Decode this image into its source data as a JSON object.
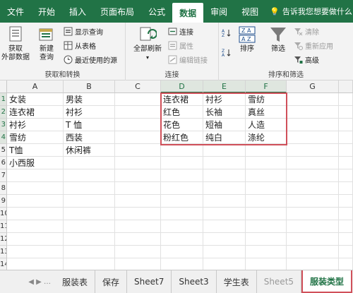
{
  "ribbon_tabs": [
    "文件",
    "开始",
    "插入",
    "页面布局",
    "公式",
    "数据",
    "审阅",
    "视图"
  ],
  "active_tab": "数据",
  "tell_me": "告诉我您想要做什么",
  "groups": {
    "get_transform": {
      "label": "获取和转换",
      "get_external": "获取\n外部数据",
      "new_query": "新建\n查询",
      "show_queries": "显示查询",
      "from_table": "从表格",
      "recent_sources": "最近使用的源"
    },
    "connections": {
      "label": "连接",
      "refresh_all": "全部刷新",
      "connections": "连接",
      "properties": "属性",
      "edit_links": "编辑链接"
    },
    "sort_filter": {
      "label": "排序和筛选",
      "sort": "排序",
      "filter": "筛选",
      "clear": "清除",
      "reapply": "重新应用",
      "advanced": "高级"
    }
  },
  "columns": [
    "A",
    "B",
    "C",
    "D",
    "E",
    "F",
    "G"
  ],
  "rows": [
    "1",
    "2",
    "3",
    "4",
    "5",
    "6",
    "7",
    "8",
    "9",
    "10",
    "11",
    "12",
    "13",
    "14"
  ],
  "cells": {
    "A1": "女装",
    "A2": "连衣裙",
    "A3": "衬衫",
    "A4": "雪纺",
    "A5": "T恤",
    "A6": "小西服",
    "B1": "男装",
    "B2": "衬衫",
    "B3": "T 恤",
    "B4": "西装",
    "B5": "休闲裤",
    "D1": "连衣裙",
    "D2": "红色",
    "D3": "花色",
    "D4": "粉红色",
    "E1": "衬衫",
    "E2": "长袖",
    "E3": "短袖",
    "E4": "纯白",
    "F1": "雪纺",
    "F2": "真丝",
    "F3": "人造",
    "F4": "涤纶"
  },
  "sheet_tabs": [
    "服装表",
    "保存",
    "Sheet7",
    "Sheet3",
    "学生表",
    "Sheet5",
    "服装类型"
  ],
  "active_sheet": "服装类型",
  "colors": {
    "brand": "#217346",
    "selection": "#d0505a"
  }
}
